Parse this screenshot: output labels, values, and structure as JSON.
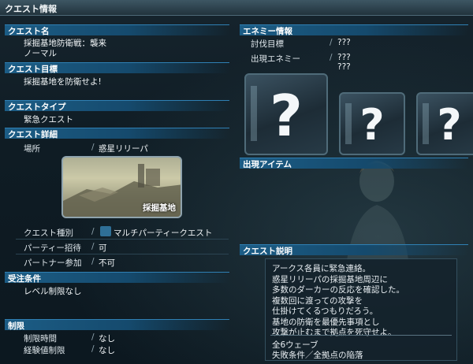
{
  "window": {
    "title": "クエスト情報"
  },
  "sections": {
    "quest_name": {
      "header": "クエスト名",
      "name": "採掘基地防衛戦：襲来",
      "difficulty": "ノーマル"
    },
    "quest_goal": {
      "header": "クエスト目標",
      "text": "採掘基地を防衛せよ!"
    },
    "quest_type": {
      "header": "クエストタイプ",
      "text": "緊急クエスト"
    },
    "quest_detail": {
      "header": "クエスト詳細",
      "location_label": "場所",
      "location_value": "惑星リリーパ",
      "thumb_caption": "採掘基地",
      "kind_label": "クエスト種別",
      "kind_value": "マルチパーティークエスト",
      "party_invite_label": "パーティー招待",
      "party_invite_value": "可",
      "partner_label": "パートナー参加",
      "partner_value": "不可"
    },
    "conditions": {
      "header": "受注条件",
      "text": "レベル制限なし"
    },
    "limits": {
      "header": "制限",
      "time_label": "制限時間",
      "time_value": "なし",
      "exp_label": "経験値制限",
      "exp_value": "なし"
    },
    "enemy_info": {
      "header": "エネミー情報",
      "target_label": "討伐目標",
      "target_value": "???",
      "appear_label": "出現エネミー",
      "appear_values": [
        "???",
        "???"
      ],
      "unknown_glyph": "?"
    },
    "items": {
      "header": "出現アイテム"
    },
    "description": {
      "header": "クエスト説明",
      "lines": [
        "アークス各員に緊急連絡。",
        "惑星リリーパの採掘基地周辺に",
        "多数のダーカーの反応を確認した。",
        "複数回に渡っての攻撃を",
        "仕掛けてくるつもりだろう。",
        "基地の防衛を最優先事項とし",
        "攻撃が止むまで拠点を死守せよ。"
      ],
      "waves": "全6ウェーブ",
      "fail_condition": "失敗条件／全拠点の陥落"
    }
  },
  "colors": {
    "section_header": "#1c5d86",
    "panel_border": "#4f6b79"
  }
}
